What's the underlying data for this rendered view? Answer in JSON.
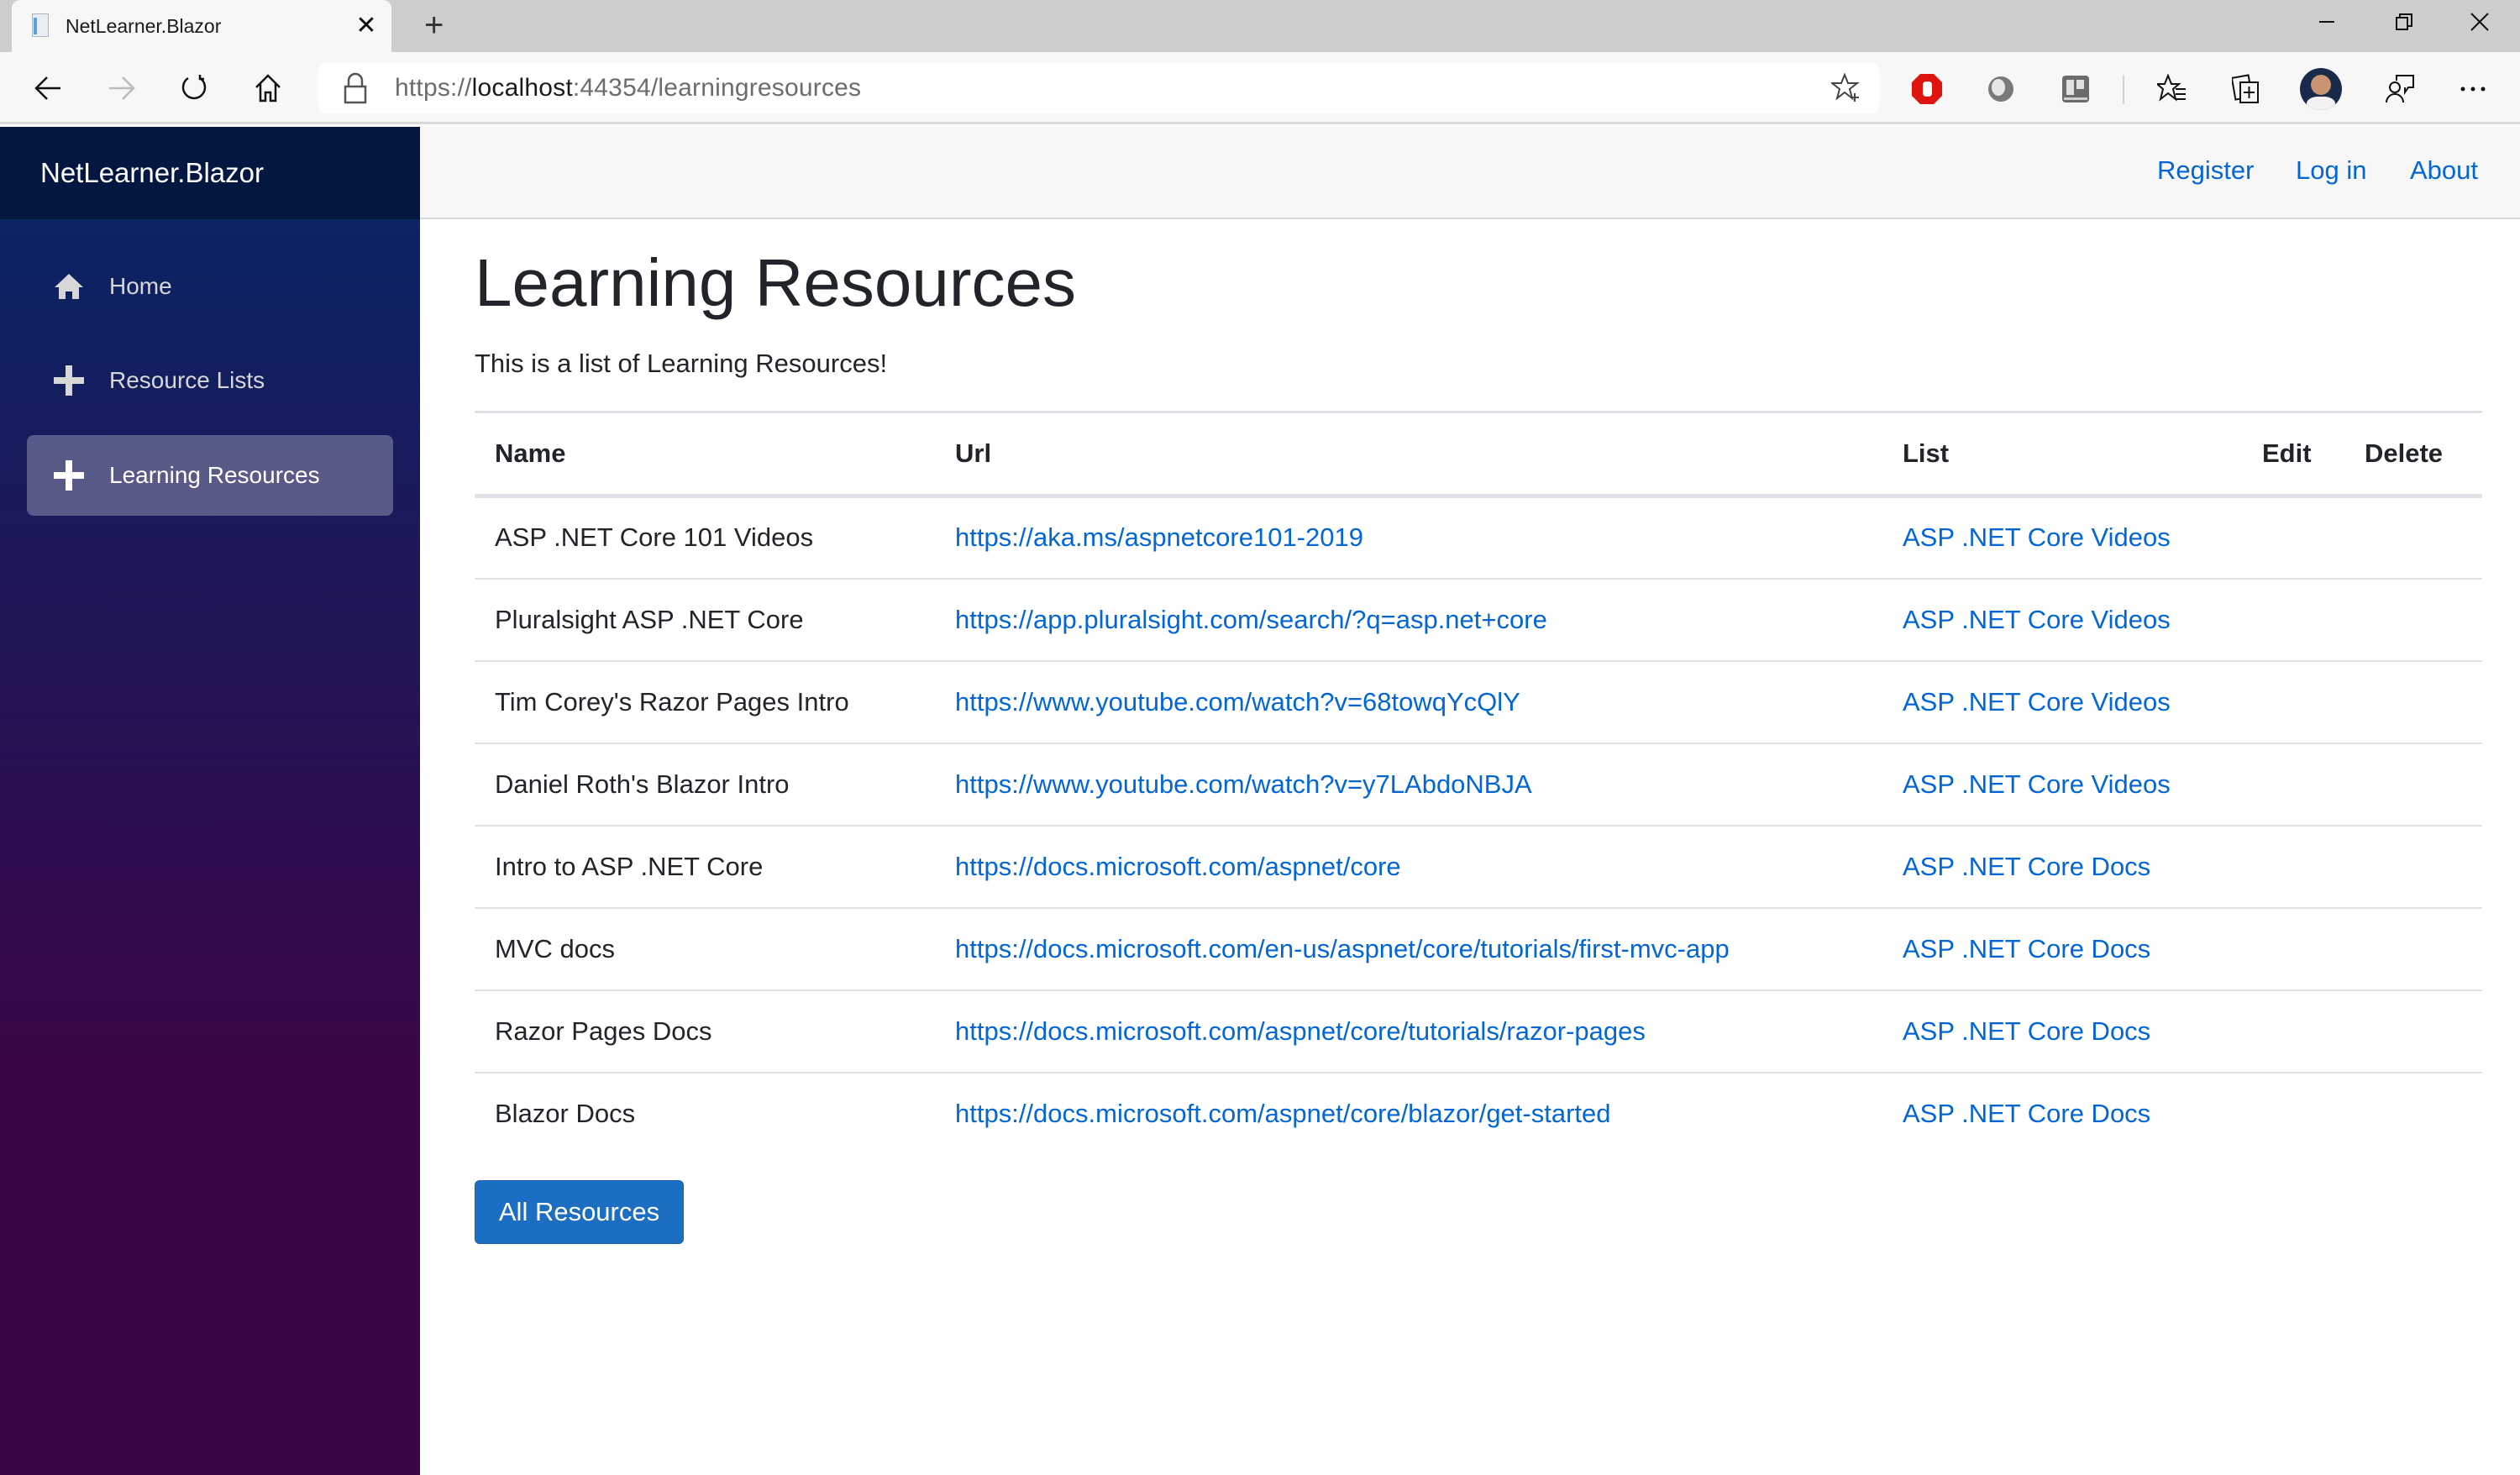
{
  "browser": {
    "tab": {
      "title": "NetLearner.Blazor",
      "favicon": "page-icon",
      "close_icon": "close-icon"
    },
    "new_tab_icon": "plus-icon",
    "window_controls": [
      "minimize-icon",
      "restore-icon",
      "close-icon"
    ],
    "nav": {
      "back": "arrow-left-icon",
      "forward": "arrow-right-icon",
      "refresh": "refresh-icon",
      "home": "home-icon"
    },
    "address": {
      "scheme": "https://",
      "host": "localhost",
      "rest": ":44354/learningresources"
    },
    "extensions": [
      "adblock-icon",
      "circle-extension-icon",
      "trello-icon"
    ],
    "toolbar_icons": [
      "favorites-icon",
      "collections-icon",
      "profile-avatar",
      "feedback-icon",
      "more-icon"
    ]
  },
  "app": {
    "brand": "NetLearner.Blazor",
    "sidebar": {
      "items": [
        {
          "label": "Home",
          "icon": "home-icon",
          "active": false
        },
        {
          "label": "Resource Lists",
          "icon": "plus-icon",
          "active": false
        },
        {
          "label": "Learning Resources",
          "icon": "plus-icon",
          "active": true
        }
      ]
    },
    "topbar": {
      "links": [
        "Register",
        "Log in",
        "About"
      ]
    },
    "colors": {
      "link": "#0366d6",
      "primary": "#1b6ec2",
      "sidebar_top": "#052767",
      "sidebar_bottom": "#3a0647"
    }
  },
  "page": {
    "title": "Learning Resources",
    "subtitle": "This is a list of Learning Resources!",
    "table": {
      "headers": [
        "Name",
        "Url",
        "List",
        "Edit",
        "Delete"
      ],
      "rows": [
        {
          "name": "ASP .NET Core 101 Videos",
          "url": "https://aka.ms/aspnetcore101-2019",
          "list": "ASP .NET Core Videos"
        },
        {
          "name": "Pluralsight ASP .NET Core",
          "url": "https://app.pluralsight.com/search/?q=asp.net+core",
          "list": "ASP .NET Core Videos"
        },
        {
          "name": "Tim Corey's Razor Pages Intro",
          "url": "https://www.youtube.com/watch?v=68towqYcQlY",
          "list": "ASP .NET Core Videos"
        },
        {
          "name": "Daniel Roth's Blazor Intro",
          "url": "https://www.youtube.com/watch?v=y7LAbdoNBJA",
          "list": "ASP .NET Core Videos"
        },
        {
          "name": "Intro to ASP .NET Core",
          "url": "https://docs.microsoft.com/aspnet/core",
          "list": "ASP .NET Core Docs"
        },
        {
          "name": "MVC docs",
          "url": "https://docs.microsoft.com/en-us/aspnet/core/tutorials/first-mvc-app",
          "list": "ASP .NET Core Docs"
        },
        {
          "name": "Razor Pages Docs",
          "url": "https://docs.microsoft.com/aspnet/core/tutorials/razor-pages",
          "list": "ASP .NET Core Docs"
        },
        {
          "name": "Blazor Docs",
          "url": "https://docs.microsoft.com/aspnet/core/blazor/get-started",
          "list": "ASP .NET Core Docs"
        }
      ]
    },
    "all_resources_button": "All Resources"
  }
}
